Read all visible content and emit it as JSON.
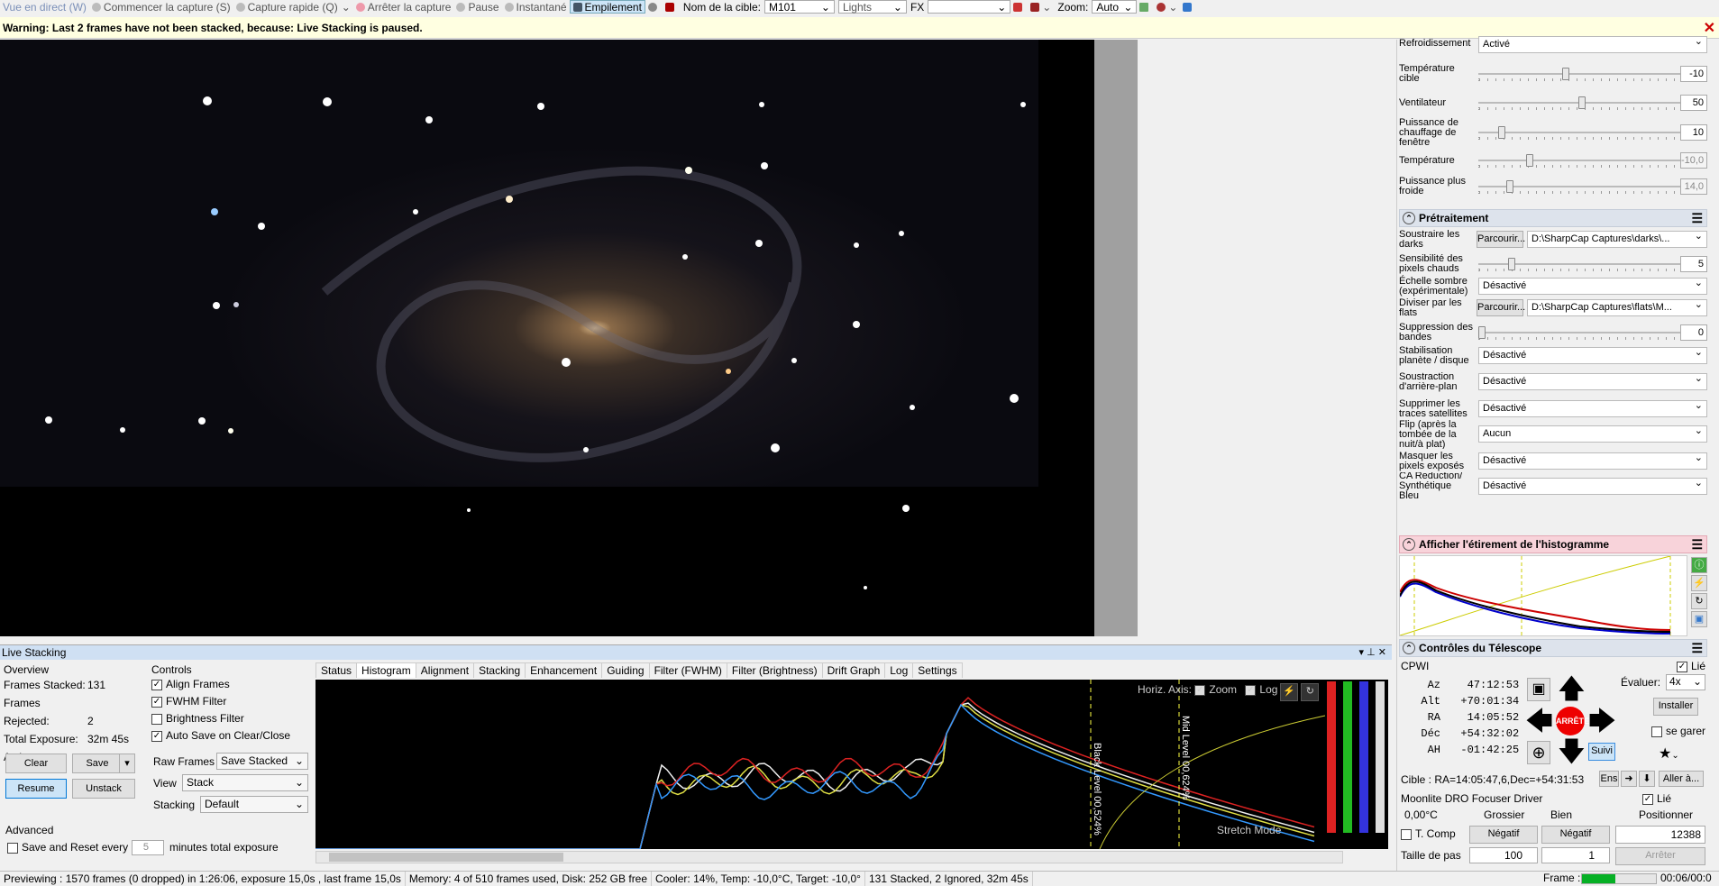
{
  "toolbar": {
    "live_view": "Vue en direct (W)",
    "start_capture": "Commencer la capture (S)",
    "quick_capture": "Capture rapide (Q)",
    "stop_capture": "Arrêter la capture",
    "pause": "Pause",
    "snapshot": "Instantané",
    "stacking": "Empilement",
    "target_label": "Nom de la cible:",
    "target_value": "M101",
    "frame_type": "Lights",
    "fx_label": "FX",
    "fx_value": "",
    "zoom_label": "Zoom:",
    "zoom_value": "Auto"
  },
  "warning": "Warning: Last 2 frames have not been stacked, because: Live Stacking is paused.",
  "camera_controls": {
    "cooling_label": "Refroidissement",
    "cooling_value": "Activé",
    "target_temp_label": "Température cible",
    "target_temp_value": "-10",
    "target_temp_level": 0.42,
    "fan_label": "Ventilateur",
    "fan_value": "50",
    "fan_level": 0.5,
    "heater_label": "Puissance de chauffage de fenêtre",
    "heater_value": "10",
    "heater_level": 0.1,
    "temp_label": "Température",
    "temp_value": "-10,0",
    "temp_level": 0.24,
    "colder_label": "Puissance plus froide",
    "colder_value": "14,0",
    "colder_level": 0.14
  },
  "preprocessing": {
    "title": "Prétraitement",
    "darks_label": "Soustraire les darks",
    "browse": "Parcourir...",
    "darks_path": "D:\\SharpCap Captures\\darks\\...",
    "hotpix_label": "Sensibilité des pixels chauds",
    "hotpix_value": "5",
    "hotpix_level": 0.15,
    "darkscale_label": "Échelle sombre (expérimentale)",
    "darkscale_value": "Désactivé",
    "flats_label": "Diviser par les flats",
    "flats_path": "D:\\SharpCap Captures\\flats\\M...",
    "banding_label": "Suppression des bandes",
    "banding_value": "0",
    "banding_level": 0.0,
    "stab_label": "Stabilisation planète / disque",
    "stab_value": "Désactivé",
    "bg_label": "Soustraction d'arrière-plan",
    "bg_value": "Désactivé",
    "sat_label": "Supprimer les traces satellites",
    "sat_value": "Désactivé",
    "flip_label": "Flip (après la tombée de la nuit/à plat)",
    "flip_value": "Aucun",
    "mask_label": "Masquer les pixels exposés",
    "mask_value": "Désactivé",
    "ca_label": "CA Reduction/ Synthétique Bleu",
    "ca_value": "Désactivé"
  },
  "histostretch": {
    "title": "Afficher l'étirement de l'histogramme"
  },
  "telescope": {
    "title": "Contrôles du Télescope",
    "mount": "CPWI",
    "linked": "Lié",
    "az_label": "Az",
    "az": "47:12:53",
    "alt_label": "Alt",
    "alt": "+70:01:34",
    "ra_label": "RA",
    "ra": "14:05:52",
    "dec_label": "Déc",
    "dec": "+54:32:02",
    "ah_label": "AH",
    "ah": "-01:42:25",
    "rate_label": "Évaluer:",
    "rate": "4x",
    "park_btn": "Installer",
    "unpark_label": "se garer",
    "stop_btn": "ARRÊTE",
    "track_btn": "Suivi",
    "target": "Cible : RA=14:05:47,6,Dec=+54:31:53",
    "set_btn": "Ens",
    "goto_btn": "Aller à..."
  },
  "focuser": {
    "name": "Moonlite DRO Focuser Driver",
    "linked": "Lié",
    "temp": "0,00°C",
    "coarse": "Grossier",
    "fine": "Bien",
    "position_label": "Positionner",
    "tcomp": "T. Comp",
    "neg1": "Négatif",
    "neg2": "Négatif",
    "position": "12388",
    "step_label": "Taille de pas",
    "step_coarse": "100",
    "step_fine": "1",
    "stop": "Arrêter"
  },
  "live_stacking": {
    "title": "Live Stacking",
    "overview": "Overview",
    "frames_stacked_label": "Frames Stacked:",
    "frames_stacked": "131",
    "frames_rejected_label": "Frames Rejected:",
    "frames_rejected": "2",
    "total_exposure_label": "Total Exposure:",
    "total_exposure": "32m 45s",
    "actions": "Actions",
    "clear": "Clear",
    "save": "Save",
    "resume": "Resume",
    "unstack": "Unstack",
    "advanced": "Advanced",
    "save_reset": "Save and Reset every",
    "save_reset_value": "5",
    "save_reset_unit": "minutes total exposure",
    "controls": "Controls",
    "align": "Align Frames",
    "fwhm": "FWHM Filter",
    "brightness": "Brightness Filter",
    "autosave": "Auto Save on Clear/Close",
    "raw_frames_label": "Raw Frames",
    "raw_frames": "Save Stacked",
    "view_label": "View",
    "view": "Stack",
    "stacking_label": "Stacking",
    "stacking": "Default",
    "tabs": [
      "Status",
      "Histogram",
      "Alignment",
      "Stacking",
      "Enhancement",
      "Guiding",
      "Filter (FWHM)",
      "Filter (Brightness)",
      "Drift Graph",
      "Log",
      "Settings"
    ],
    "horiz_axis": "Horiz. Axis:",
    "zoom": "Zoom",
    "log": "Log",
    "black_level": "Black Level 00,524%",
    "mid_level": "Mid Level 00,624%",
    "stretch_mode": "Stretch Mode"
  },
  "status": {
    "preview": "Previewing : 1570 frames (0 dropped) in 1:26:06, exposure 15,0s , last frame 15,0s",
    "memory": "Memory: 4 of 510 frames used, Disk: 252 GB free",
    "cooler": "Cooler: 14%, Temp: -10,0°C, Target: -10,0°",
    "stacked": "131 Stacked, 2 Ignored, 32m 45s",
    "frame_label": "Frame :",
    "time": "00:06/00:0"
  }
}
